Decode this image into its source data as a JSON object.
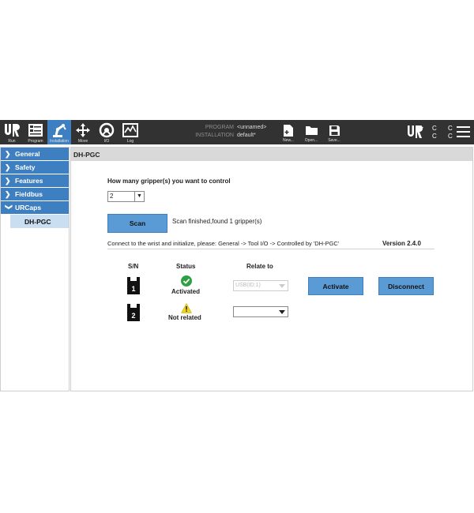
{
  "toolbar": {
    "nav": [
      {
        "label": "Run",
        "icon": "ur-logo-icon"
      },
      {
        "label": "Program",
        "icon": "program-icon"
      },
      {
        "label": "Installation",
        "icon": "installation-robot-icon"
      },
      {
        "label": "Move",
        "icon": "move-arrows-icon"
      },
      {
        "label": "I/O",
        "icon": "io-icon"
      },
      {
        "label": "Log",
        "icon": "log-icon"
      }
    ],
    "program_key": "PROGRAM",
    "program_value": "<unnamed>",
    "installation_key": "INSTALLATION",
    "installation_value": "default*",
    "file": [
      {
        "label": "New...",
        "icon": "new-file-icon"
      },
      {
        "label": "Open...",
        "icon": "open-folder-icon"
      },
      {
        "label": "Save...",
        "icon": "save-icon"
      }
    ],
    "cc": "C C\nC C",
    "accent": "#3d7fc0"
  },
  "sidebar": {
    "items": [
      {
        "label": "General"
      },
      {
        "label": "Safety"
      },
      {
        "label": "Features"
      },
      {
        "label": "Fieldbus"
      },
      {
        "label": "URCaps"
      }
    ],
    "sub_item": "DH-PGC"
  },
  "main": {
    "title": "DH-PGC",
    "question": "How many gripper(s) you want to control",
    "count_value": "2",
    "scan_label": "Scan",
    "scan_status": "Scan finished,found 1 gripper(s)",
    "connect_text": "Connect to the wrist and initialize, please: General -> Tool  I/O -> Controlled by 'DH-PGC'",
    "version": "Version 2.4.0",
    "headers": {
      "sn": "S/N",
      "status": "Status",
      "relate": "Relate to"
    },
    "grippers": [
      {
        "sn": "1",
        "status": "Activated",
        "relate": "USB(ID:1)",
        "status_color": "#2ea043"
      },
      {
        "sn": "2",
        "status": "Not related",
        "relate": "",
        "status_color": "#f2d21b"
      }
    ],
    "activate_label": "Activate",
    "disconnect_label": "Disconnect"
  }
}
